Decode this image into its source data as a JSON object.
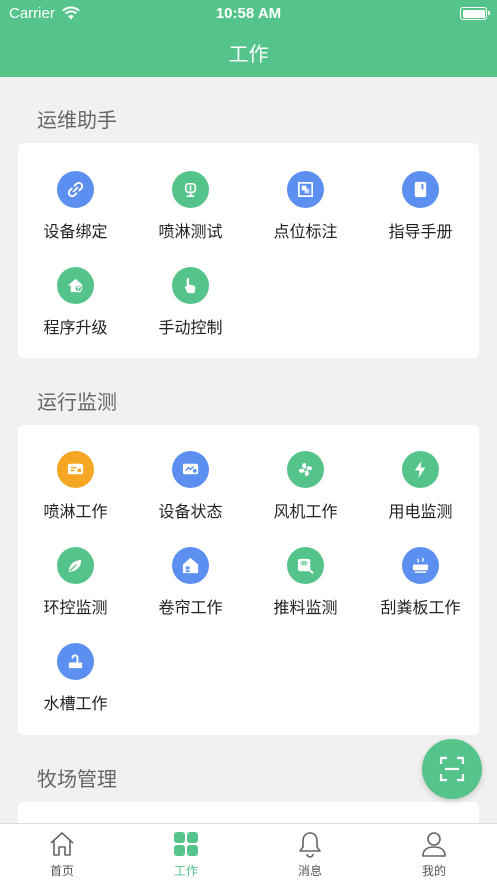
{
  "status_bar": {
    "carrier": "Carrier",
    "time": "10:58 AM"
  },
  "header": {
    "title": "工作"
  },
  "colors": {
    "primary": "#55c48a",
    "blue": "#5b8ff0",
    "orange": "#f5a623",
    "background": "#f0f1f0"
  },
  "sections": [
    {
      "title": "运维助手",
      "items": [
        {
          "label": "设备绑定",
          "icon": "link-icon",
          "color": "#5b8ff0"
        },
        {
          "label": "喷淋测试",
          "icon": "sprinkler-icon",
          "color": "#55c48a"
        },
        {
          "label": "点位标注",
          "icon": "mark-icon",
          "color": "#5b8ff0"
        },
        {
          "label": "指导手册",
          "icon": "manual-icon",
          "color": "#5b8ff0"
        },
        {
          "label": "程序升级",
          "icon": "upgrade-icon",
          "color": "#55c48a"
        },
        {
          "label": "手动控制",
          "icon": "hand-icon",
          "color": "#55c48a"
        }
      ]
    },
    {
      "title": "运行监测",
      "items": [
        {
          "label": "喷淋工作",
          "icon": "spray-work-icon",
          "color": "#f5a623"
        },
        {
          "label": "设备状态",
          "icon": "device-status-icon",
          "color": "#5b8ff0"
        },
        {
          "label": "风机工作",
          "icon": "fan-icon",
          "color": "#55c48a"
        },
        {
          "label": "用电监测",
          "icon": "lightning-icon",
          "color": "#55c48a"
        },
        {
          "label": "环控监测",
          "icon": "leaf-icon",
          "color": "#55c48a"
        },
        {
          "label": "卷帘工作",
          "icon": "curtain-icon",
          "color": "#5b8ff0"
        },
        {
          "label": "推料监测",
          "icon": "feed-icon",
          "color": "#55c48a"
        },
        {
          "label": "刮粪板工作",
          "icon": "scraper-icon",
          "color": "#5b8ff0"
        },
        {
          "label": "水槽工作",
          "icon": "faucet-icon",
          "color": "#5b8ff0"
        }
      ]
    },
    {
      "title": "牧场管理",
      "items": []
    }
  ],
  "tabs": [
    {
      "label": "首页",
      "icon": "home-icon",
      "active": false
    },
    {
      "label": "工作",
      "icon": "grid-icon",
      "active": true
    },
    {
      "label": "消息",
      "icon": "bell-icon",
      "active": false
    },
    {
      "label": "我的",
      "icon": "profile-icon",
      "active": false
    }
  ],
  "fab": {
    "icon": "scan-icon"
  }
}
